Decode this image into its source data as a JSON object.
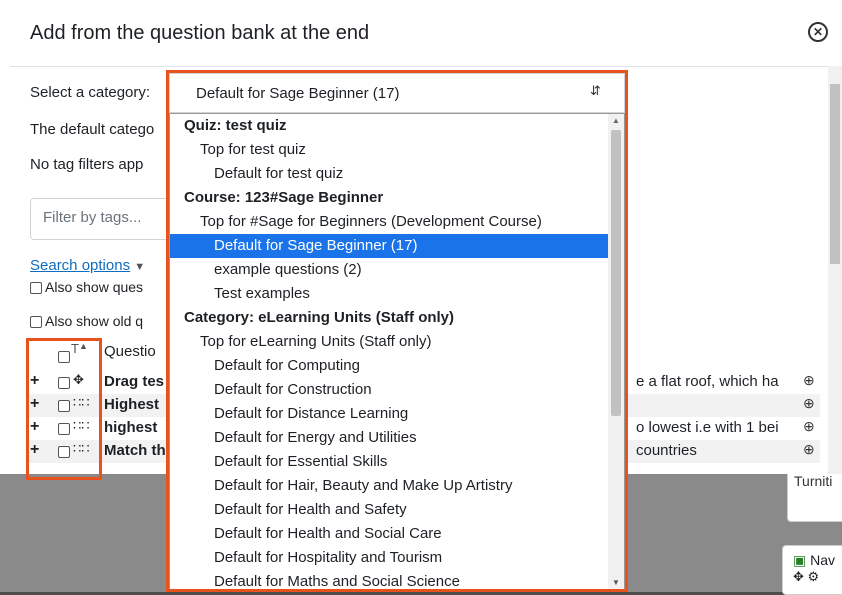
{
  "modal": {
    "title": "Add from the question bank at the end",
    "close_icon": "close-circle-icon"
  },
  "form": {
    "category_label": "Select a category:",
    "default_category_text": "The default catego",
    "tag_filters_text": "No tag filters app",
    "filter_placeholder": "Filter by tags...",
    "search_options_link": "Search options",
    "search_options_icon": "caret-down-icon",
    "also_show_questions": "Also show ques",
    "also_show_old": "Also show old q"
  },
  "table": {
    "header_type": "T",
    "header_sort_icon": "sort-up-icon",
    "header_question": "Questio",
    "rows": [
      {
        "type_icon": "drag-move-icon",
        "name": "Drag tes",
        "tail": "e a flat roof, which ha"
      },
      {
        "type_icon": "order-list-icon",
        "name": "Highest",
        "tail": ""
      },
      {
        "type_icon": "order-list-icon",
        "name": "highest",
        "tail": "o lowest i.e with 1 bei"
      },
      {
        "type_icon": "order-list-icon",
        "name": "Match th",
        "tail": "countries"
      }
    ]
  },
  "dropdown": {
    "selected": "Default for Sage Beginner (17)",
    "options": [
      {
        "label": "Quiz: test quiz",
        "kind": "group"
      },
      {
        "label": "Top for test quiz",
        "kind": "l1"
      },
      {
        "label": "Default for test quiz",
        "kind": "l2"
      },
      {
        "label": "Course: 123#Sage Beginner",
        "kind": "group"
      },
      {
        "label": "Top for #Sage for Beginners (Development Course)",
        "kind": "l1"
      },
      {
        "label": "Default for Sage Beginner (17)",
        "kind": "l2",
        "selected": true
      },
      {
        "label": "example questions (2)",
        "kind": "l2"
      },
      {
        "label": "Test examples",
        "kind": "l2"
      },
      {
        "label": "Category: eLearning Units (Staff only)",
        "kind": "group"
      },
      {
        "label": "Top for eLearning Units (Staff only)",
        "kind": "l1"
      },
      {
        "label": "Default for Computing",
        "kind": "l2"
      },
      {
        "label": "Default for Construction",
        "kind": "l2"
      },
      {
        "label": "Default for Distance Learning",
        "kind": "l2"
      },
      {
        "label": "Default for Energy and Utilities",
        "kind": "l2"
      },
      {
        "label": "Default for Essential Skills",
        "kind": "l2"
      },
      {
        "label": "Default for Hair, Beauty and Make Up Artistry",
        "kind": "l2"
      },
      {
        "label": "Default for Health and Safety",
        "kind": "l2"
      },
      {
        "label": "Default for Health and Social Care",
        "kind": "l2"
      },
      {
        "label": "Default for Hospitality and Tourism",
        "kind": "l2"
      },
      {
        "label": "Default for Maths and Social Science",
        "kind": "l2"
      }
    ]
  },
  "background_page": {
    "turnitin_label": "Turniti",
    "nav_label": "Nav",
    "nav_icon": "sitemap-icon"
  },
  "colors": {
    "highlight": "#e8531d",
    "selected_option": "#1a73e8",
    "link": "#0f6cbf"
  }
}
